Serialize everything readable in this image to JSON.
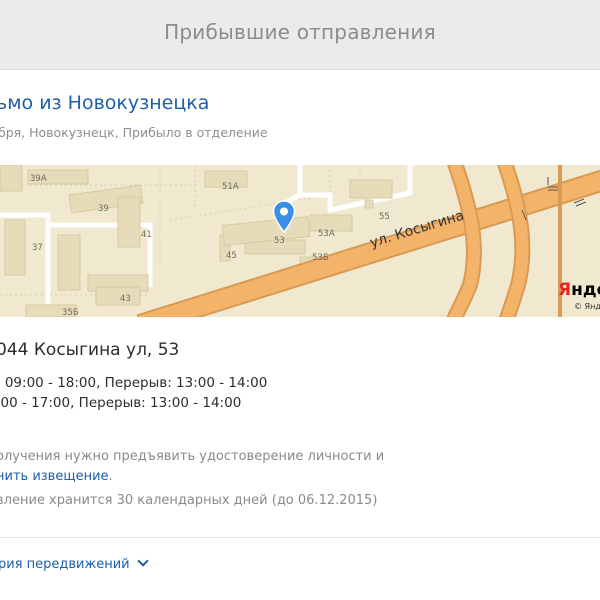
{
  "header": {
    "title": "Прибывшие отправления"
  },
  "letter": {
    "title": "ьмо из Новокузнецка",
    "subtitle": "бря, Новокузнецк, Прибыло в отделение"
  },
  "map": {
    "street": "ул. Косыгина",
    "building_labels": [
      "39А",
      "51А",
      "39",
      "55",
      "41",
      "53",
      "53А",
      "37",
      "45",
      "53Б",
      "43",
      "35Б"
    ],
    "logo_text_first": "Я",
    "logo_text_rest": "нде",
    "logo_sub": "© Янд"
  },
  "office": {
    "title": "044 Косыгина ул, 53",
    "schedule": [
      ": 09:00 - 18:00, Перерыв: 13:00 - 14:00",
      ":00 - 17:00, Перерыв: 13:00 - 14:00"
    ],
    "note_line1": "олучения нужно предъявить удостоверение личности и",
    "note_line2_link": "нить извещение",
    "note_line2_end": ".",
    "storage_note": "вление хранится 30 календарных дней (до 06.12.2015)"
  },
  "history": {
    "label": "рия передвижений"
  },
  "colors": {
    "link": "#1d5fa8",
    "road": "#f3b46a",
    "map_bg": "#f0e9cf",
    "pin": "#3a8ee6"
  }
}
